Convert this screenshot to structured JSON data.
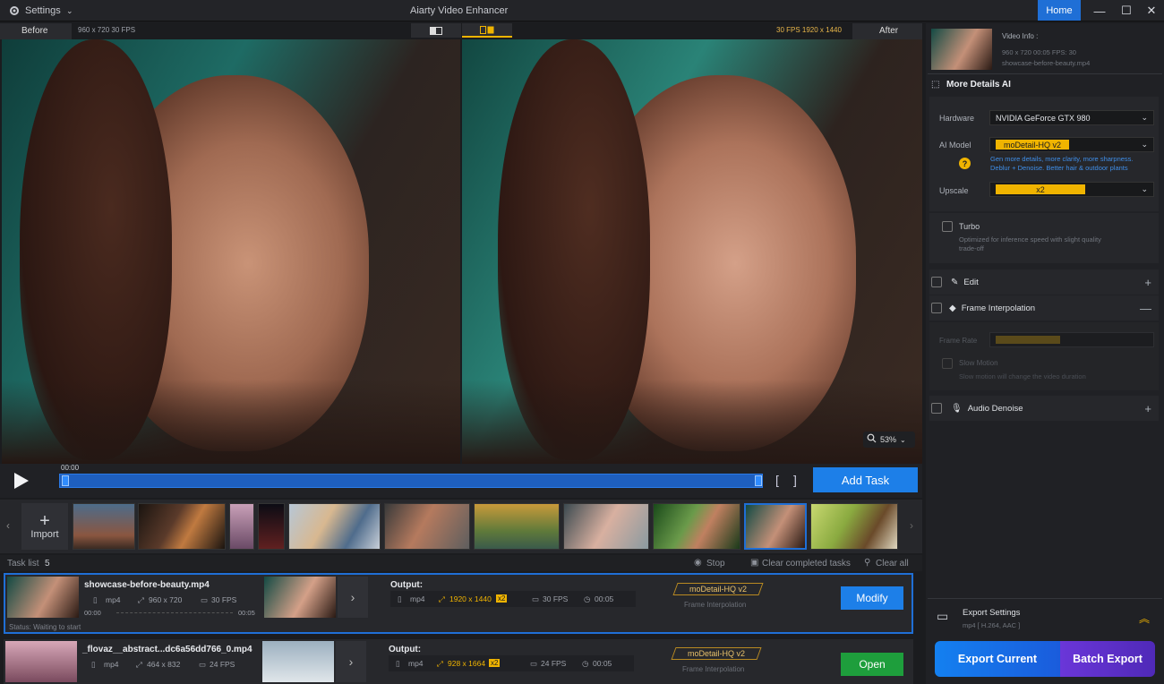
{
  "titlebar": {
    "settings_label": "Settings",
    "app_title": "Aiarty Video Enhancer",
    "home_label": "Home"
  },
  "preview": {
    "before_label": "Before",
    "before_info": "960 x 720  30 FPS",
    "after_label": "After",
    "after_info": "30 FPS  1920 x 1440",
    "zoom": "53%"
  },
  "transport": {
    "time": "00:00",
    "add_task_label": "Add Task"
  },
  "filmstrip": {
    "import_label": "Import"
  },
  "tasklist": {
    "title": "Task list",
    "count": "5",
    "stop_label": "Stop",
    "clear_completed_label": "Clear completed tasks",
    "clear_all_label": "Clear all"
  },
  "tasks": [
    {
      "name": "showcase-before-beauty.mp4",
      "format": "mp4",
      "resolution": "960 x 720",
      "fps": "30 FPS",
      "time_start": "00:00",
      "time_end": "00:05",
      "status": "Status: Waiting to start",
      "output_label": "Output:",
      "out_format": "mp4",
      "out_resolution": "1920 x 1440",
      "out_scale": "x2",
      "out_fps": "30 FPS",
      "out_duration": "00:05",
      "model": "moDetail-HQ  v2",
      "sub_model": "Frame Interpolation",
      "action_label": "Modify"
    },
    {
      "name": "_flovaz__abstract...dc6a56dd766_0.mp4",
      "format": "mp4",
      "resolution": "464 x 832",
      "fps": "24 FPS",
      "output_label": "Output:",
      "out_format": "mp4",
      "out_resolution": "928 x 1664",
      "out_scale": "x2",
      "out_fps": "24 FPS",
      "out_duration": "00:05",
      "model": "moDetail-HQ  v2",
      "sub_model": "Frame Interpolation",
      "action_label": "Open"
    }
  ],
  "panel": {
    "video_info_title": "Video Info :",
    "video_info_line": "960 x 720   00:05   FPS: 30",
    "video_file": "showcase-before-beauty.mp4",
    "more_details_title": "More Details AI",
    "hardware_label": "Hardware",
    "hardware_value": "NVIDIA GeForce GTX 980",
    "ai_model_label": "AI Model",
    "ai_model_value": "moDetail-HQ  v2",
    "ai_model_desc1": "Gen more details, more clarity, more sharpness.",
    "ai_model_desc2": "Deblur + Denoise. Better hair & outdoor plants",
    "upscale_label": "Upscale",
    "upscale_value": "x2",
    "turbo_label": "Turbo",
    "turbo_desc1": "Optimized for inference speed with slight quality",
    "turbo_desc2": "trade-off",
    "edit_label": "Edit",
    "frame_interp_label": "Frame Interpolation",
    "frame_rate_label": "Frame Rate",
    "slow_motion_label": "Slow Motion",
    "slow_motion_desc": "Slow motion will change the video duration",
    "audio_denoise_label": "Audio Denoise",
    "export_settings_label": "Export Settings",
    "export_settings_value": "mp4 [ H.264, AAC ]",
    "export_current_label": "Export Current",
    "batch_export_label": "Batch Export"
  },
  "colors": {
    "accent_blue": "#1d7fe8",
    "accent_yellow": "#f0b400",
    "open_green": "#1e9e3c",
    "batch_purple": "#6a36d8"
  }
}
